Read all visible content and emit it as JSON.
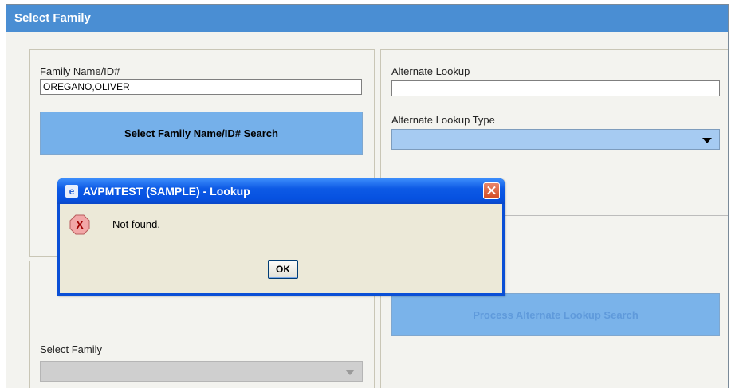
{
  "window": {
    "title": "Select Family"
  },
  "left_panel": {
    "family_label": "Family Name/ID#",
    "family_value": "OREGANO,OLIVER",
    "search_button": "Select Family Name/ID# Search"
  },
  "right_panel": {
    "alt_lookup_label": "Alternate Lookup",
    "alt_lookup_value": "",
    "alt_type_label": "Alternate Lookup Type",
    "alt_type_value": "",
    "process_button": "Process Alternate Lookup Search"
  },
  "bottom_left": {
    "select_family_label": "Select Family",
    "select_family_value": ""
  },
  "dialog": {
    "title": "AVPMTEST (SAMPLE) - Lookup",
    "message": "Not found.",
    "ok_label": "OK",
    "error_icon_glyph": "X",
    "app_icon_glyph": "e"
  },
  "colors": {
    "header": "#4a8ed3",
    "button": "#75b0ea",
    "button_disabled": "#7ab3ea",
    "dropdown": "#a6cbf2",
    "dialog_title": "#0a4fd6"
  }
}
